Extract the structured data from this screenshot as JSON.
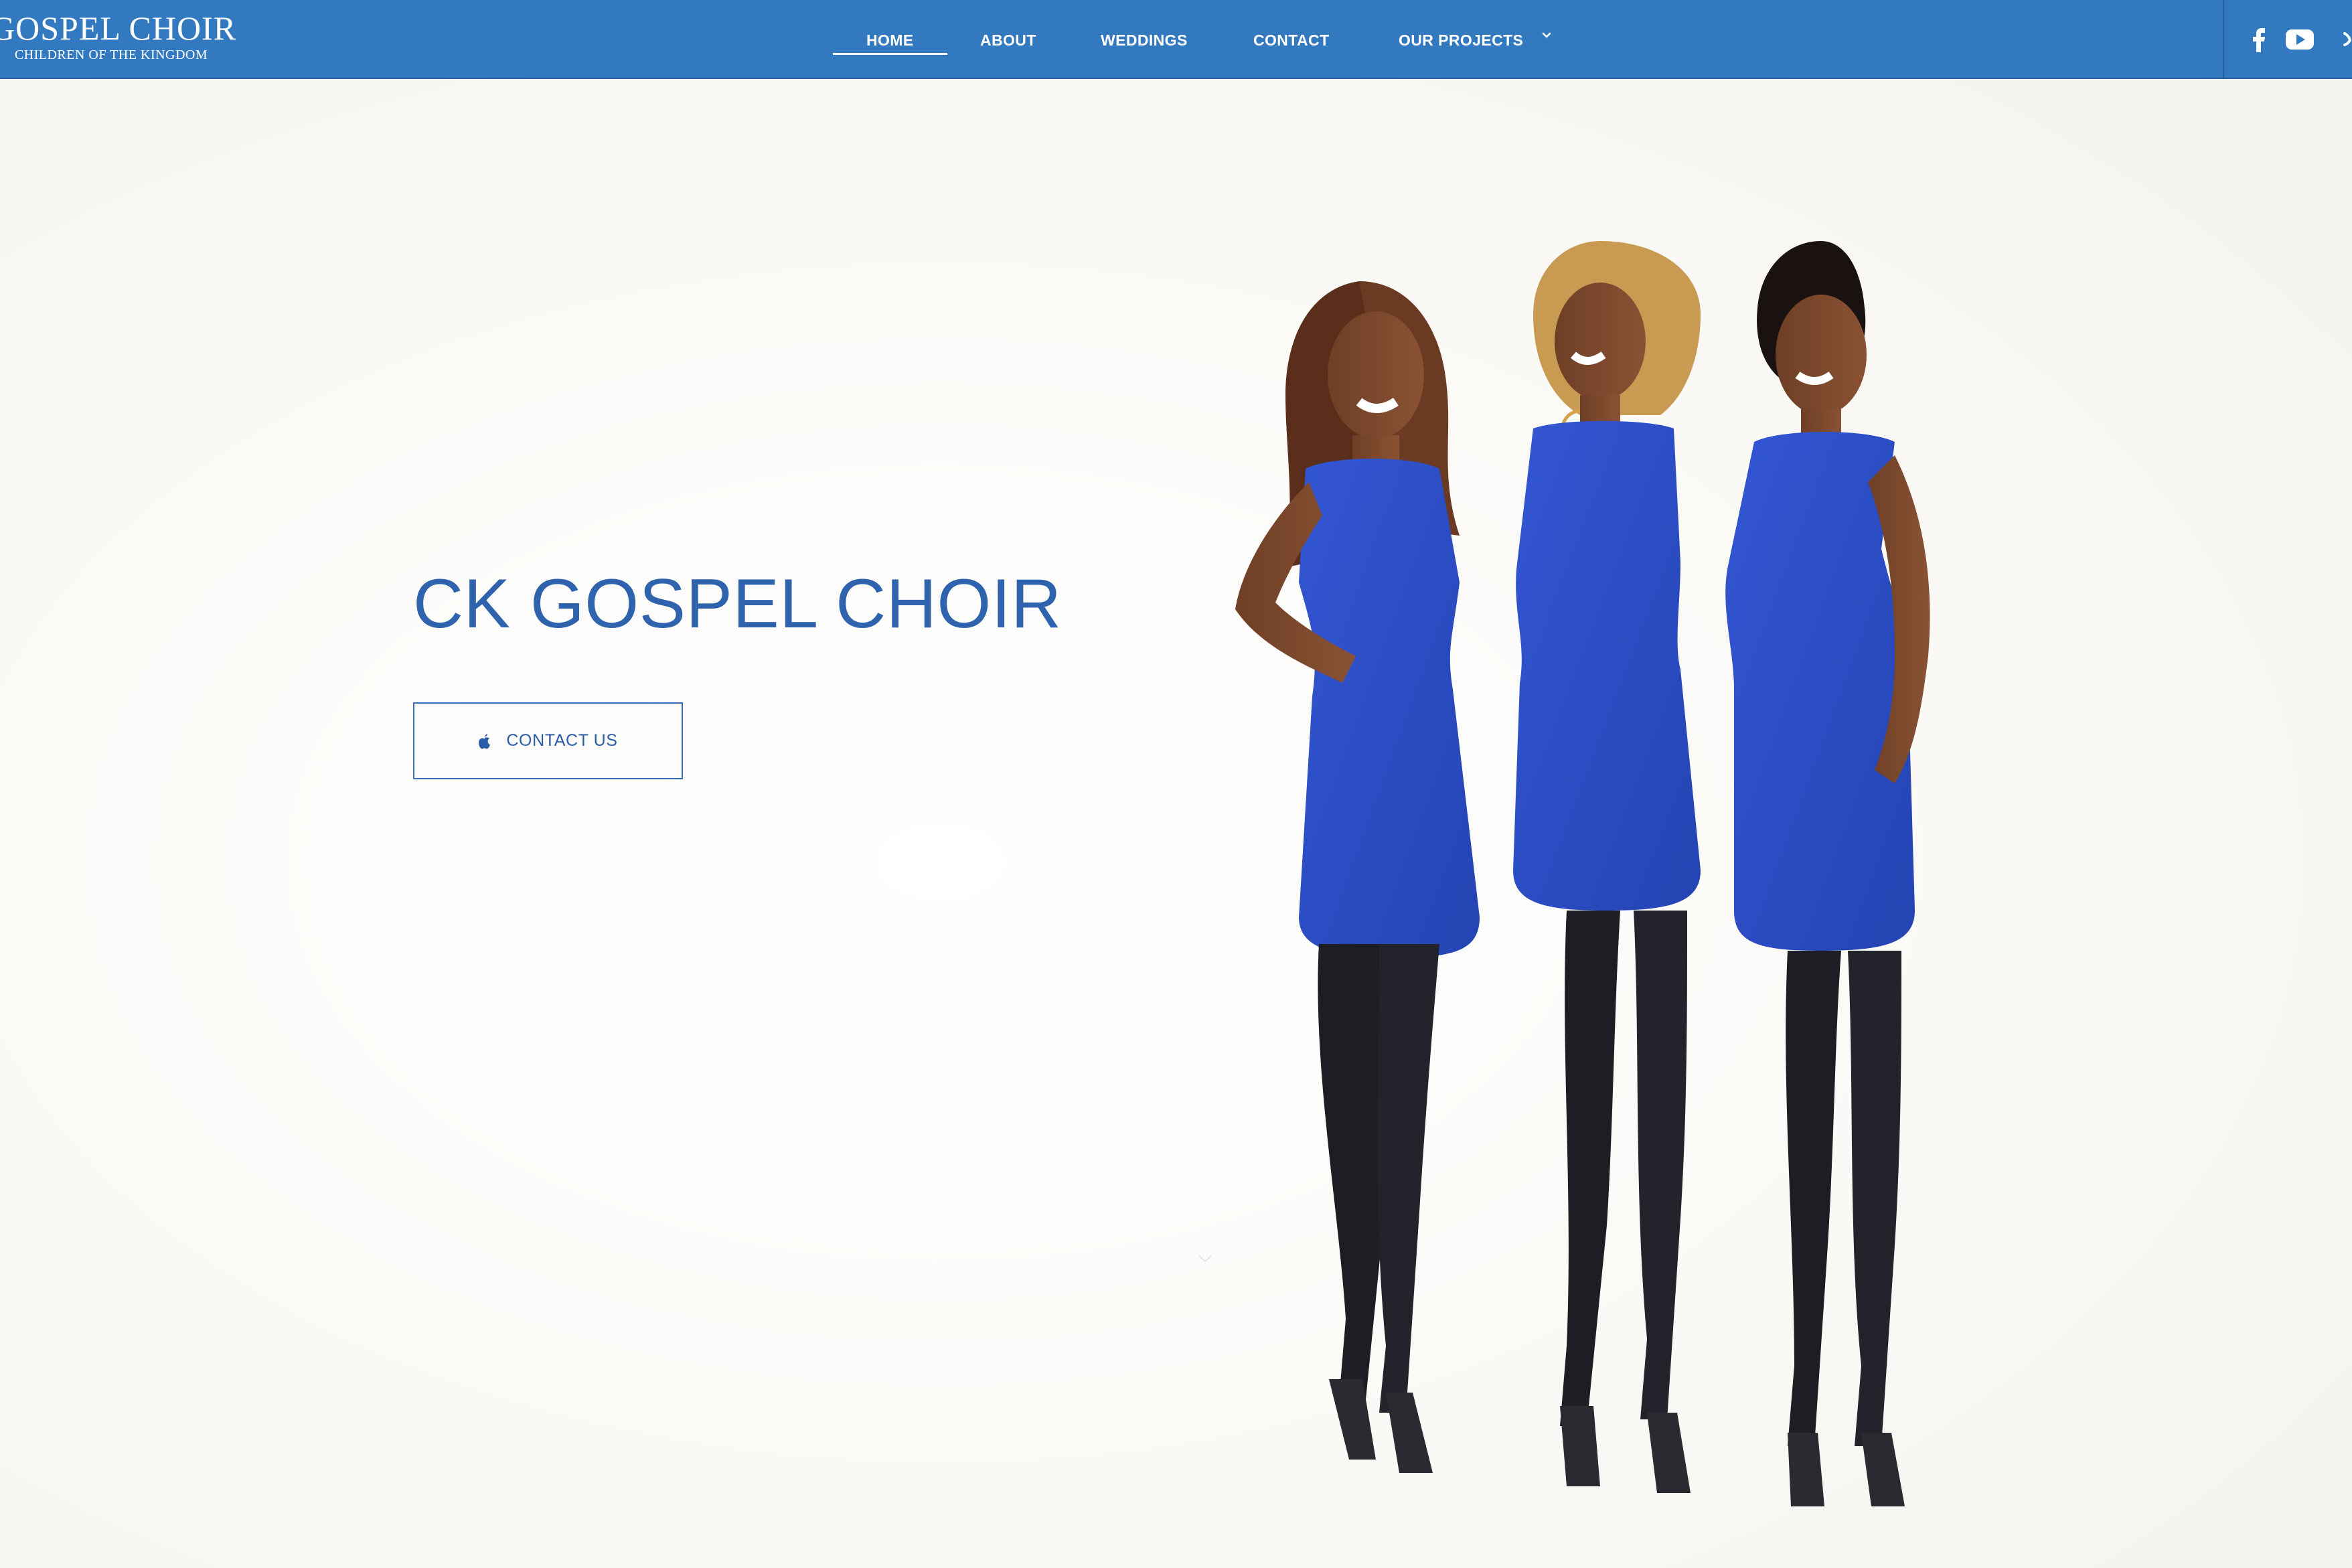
{
  "brand": {
    "title": "GOSPEL CHOIR",
    "subtitle": "CHILDREN OF THE KINGDOM"
  },
  "nav": {
    "items": [
      {
        "label": "HOME",
        "active": true
      },
      {
        "label": "ABOUT",
        "active": false
      },
      {
        "label": "WEDDINGS",
        "active": false
      },
      {
        "label": "CONTACT",
        "active": false
      },
      {
        "label": "OUR PROJECTS",
        "active": false
      }
    ],
    "social": [
      "facebook-icon",
      "youtube-icon",
      "extra-social-icon"
    ]
  },
  "hero": {
    "title": "CK GOSPEL CHOIR",
    "cta_label": "CONTACT US",
    "cta_icon": "apple-icon"
  },
  "colors": {
    "nav_background": "#3379bf",
    "accent_blue": "#2f63ad",
    "dress_blue": "#2a52c9",
    "page_background": "#fbfaf8"
  }
}
